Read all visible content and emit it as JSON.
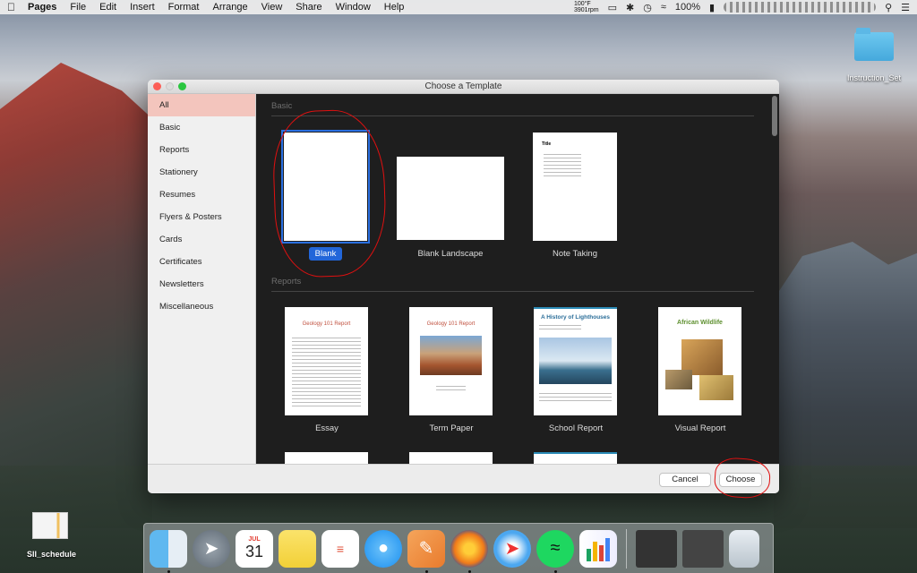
{
  "menubar": {
    "app_name": "Pages",
    "items": [
      "File",
      "Edit",
      "Insert",
      "Format",
      "Arrange",
      "View",
      "Share",
      "Window",
      "Help"
    ],
    "temp_line1": "100°F",
    "temp_line2": "3901rpm",
    "battery": "100%"
  },
  "desktop": {
    "folder_label": "Instruction_Set",
    "file_label": "SII_schedule"
  },
  "dialog": {
    "title": "Choose a Template",
    "sidebar": [
      "All",
      "Basic",
      "Reports",
      "Stationery",
      "Resumes",
      "Flyers & Posters",
      "Cards",
      "Certificates",
      "Newsletters",
      "Miscellaneous"
    ],
    "sections": {
      "basic": "Basic",
      "reports": "Reports"
    },
    "basic_templates": [
      "Blank",
      "Blank Landscape",
      "Note Taking"
    ],
    "report_templates": [
      "Essay",
      "Term Paper",
      "School Report",
      "Visual Report"
    ],
    "thumb_text": {
      "essay": "Geology 101 Report",
      "term": "Geology 101 Report",
      "school": "A History of Lighthouses",
      "visual": "African Wildlife",
      "note": "Title"
    },
    "buttons": {
      "cancel": "Cancel",
      "choose": "Choose"
    }
  },
  "dock": {
    "calendar_month": "JUL",
    "calendar_day": "31"
  }
}
